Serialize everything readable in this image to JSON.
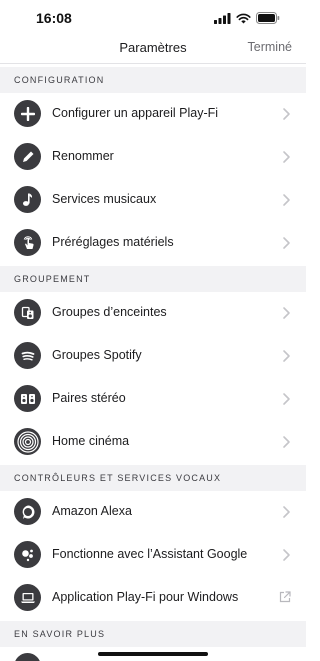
{
  "status_bar": {
    "time": "16:08",
    "icons": [
      "cellular-signal-icon",
      "wifi-icon",
      "battery-icon"
    ]
  },
  "nav": {
    "title": "Paramètres",
    "done_label": "Terminé"
  },
  "sections": [
    {
      "title": "CONFIGURATION",
      "items": [
        {
          "label": "Configurer un appareil Play-Fi",
          "icon": "plus-icon",
          "accessory": "chevron"
        },
        {
          "label": "Renommer",
          "icon": "pencil-icon",
          "accessory": "chevron"
        },
        {
          "label": "Services musicaux",
          "icon": "music-note-icon",
          "accessory": "chevron"
        },
        {
          "label": "Préréglages matériels",
          "icon": "hand-tap-icon",
          "accessory": "chevron"
        }
      ]
    },
    {
      "title": "GROUPEMENT",
      "items": [
        {
          "label": "Groupes d’enceintes",
          "icon": "speaker-group-icon",
          "accessory": "chevron"
        },
        {
          "label": "Groupes Spotify",
          "icon": "spotify-icon",
          "accessory": "chevron"
        },
        {
          "label": "Paires stéréo",
          "icon": "stereo-pair-icon",
          "accessory": "chevron"
        },
        {
          "label": "Home cinéma",
          "icon": "home-cinema-icon",
          "accessory": "chevron"
        }
      ]
    },
    {
      "title": "CONTRÔLEURS ET SERVICES VOCAUX",
      "items": [
        {
          "label": "Amazon Alexa",
          "icon": "alexa-icon",
          "accessory": "chevron"
        },
        {
          "label": "Fonctionne avec l’Assistant Google",
          "icon": "google-assistant-icon",
          "accessory": "chevron"
        },
        {
          "label": "Application Play-Fi pour Windows",
          "icon": "laptop-icon",
          "accessory": "external-link"
        }
      ]
    },
    {
      "title": "EN SAVOIR PLUS",
      "items": []
    }
  ],
  "colors": {
    "icon_bg": "#3b3b3f",
    "section_bg": "#f2f2f4",
    "chevron": "#c5c5c9",
    "done_text": "#6b6b70"
  }
}
